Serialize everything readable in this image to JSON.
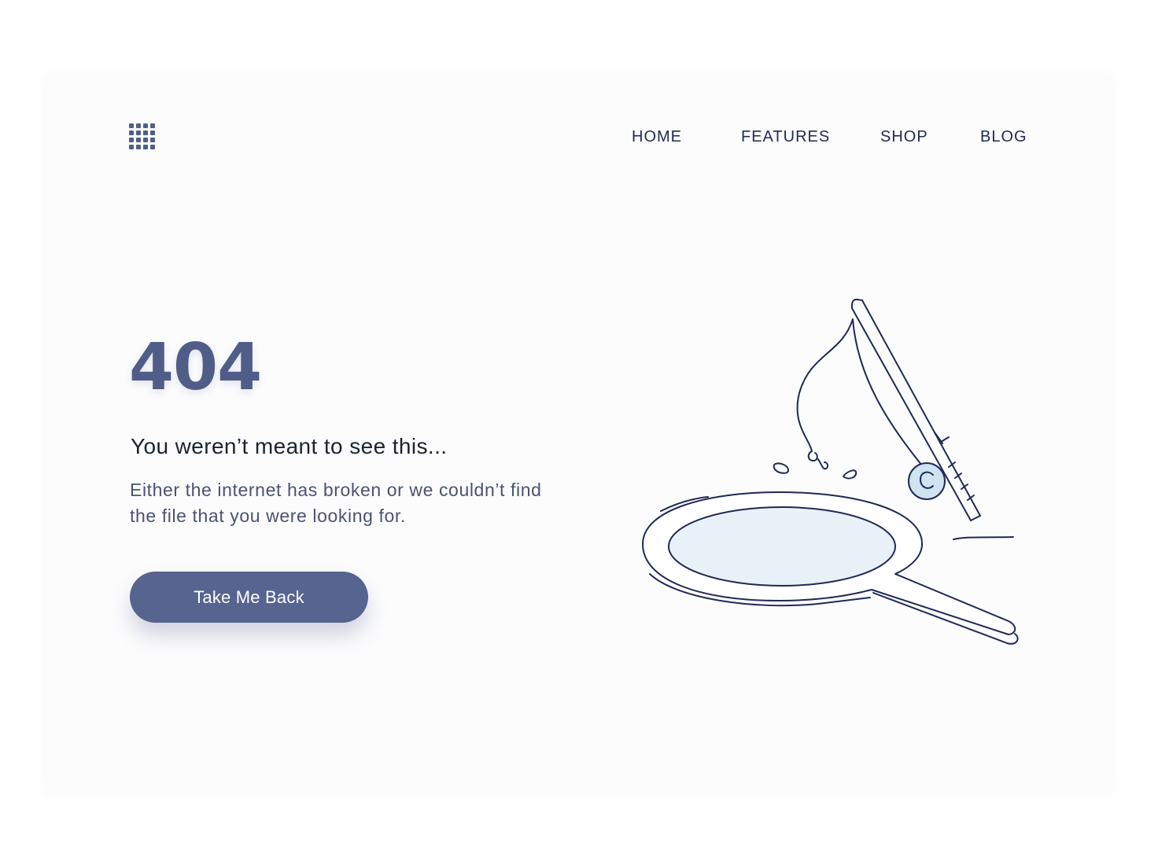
{
  "header": {
    "menu_icon": "grid-menu-icon",
    "nav": [
      {
        "label": "HOME"
      },
      {
        "label": "FEATURES"
      },
      {
        "label": "SHOP"
      },
      {
        "label": "BLOG"
      }
    ]
  },
  "main": {
    "error_code": "404",
    "headline": "You weren’t meant to see this...",
    "description": "Either the internet has broken or we couldn’t find the file that you were looking for.",
    "button_label": "Take Me Back"
  },
  "illustration": {
    "name": "fishing-net-illustration",
    "parts": [
      "fishing-rod",
      "fishing-line",
      "hook",
      "reel",
      "landing-net",
      "water-drops"
    ],
    "reel_letter": "C"
  },
  "colors": {
    "primary": "#56648f",
    "heading": "#4f5d88",
    "text_dark": "#1d2230",
    "text_muted": "#4a5372",
    "line": "#1f2a55",
    "net_fill": "#e8f1f8",
    "reel_fill": "#cfe3f0"
  }
}
